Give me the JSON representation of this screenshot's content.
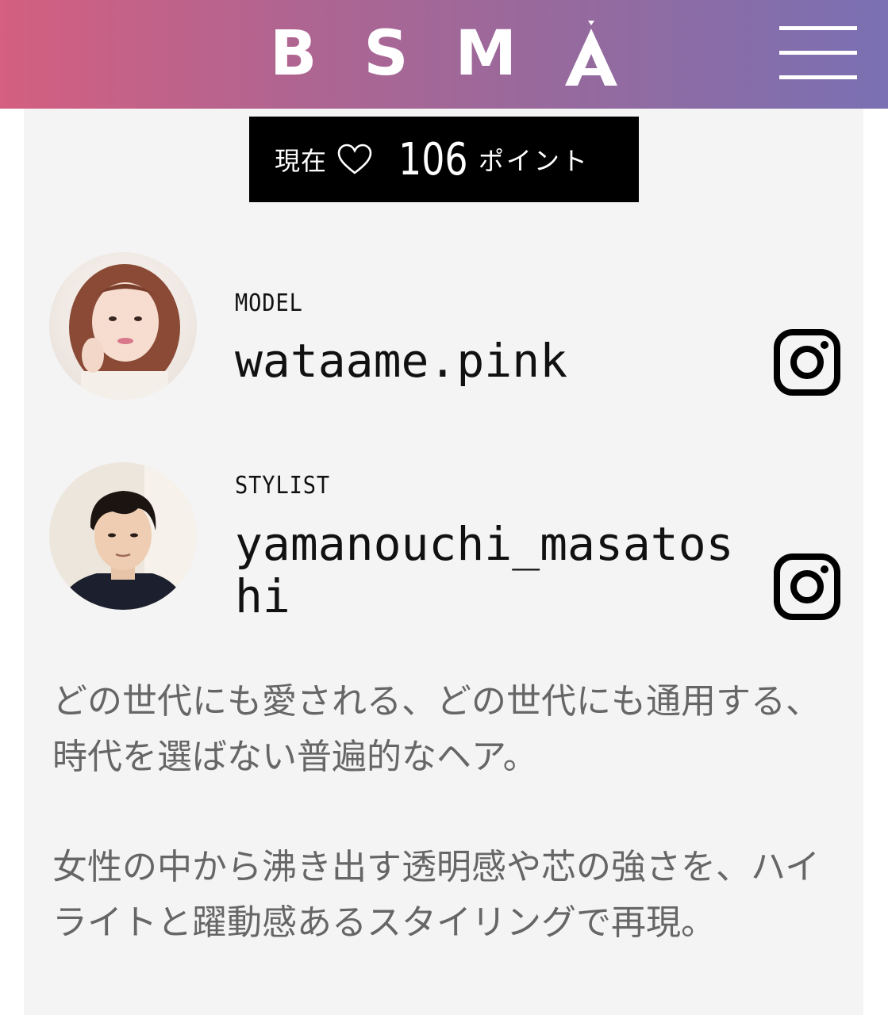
{
  "header": {
    "logo_letters": [
      "B",
      "S",
      "M",
      "A"
    ],
    "menu_icon": "hamburger-menu-icon",
    "gradient_colors": [
      "#d45f80",
      "#7a70b3"
    ]
  },
  "points_badge": {
    "label": "現在",
    "icon": "heart-outline-icon",
    "value": "106",
    "unit": "ポイント"
  },
  "credits": [
    {
      "role": "MODEL",
      "handle": "wataame.pink",
      "icon": "instagram-icon"
    },
    {
      "role": "STYLIST",
      "handle": "yamanouchi_masatoshi",
      "icon": "instagram-icon"
    }
  ],
  "description": {
    "paragraph_1": "どの世代にも愛される、どの世代にも通用する、時代を選ばない普遍的なヘア。",
    "paragraph_2": "女性の中から沸き出す透明感や芯の強さを、ハイライトと躍動感あるスタイリングで再現。"
  }
}
